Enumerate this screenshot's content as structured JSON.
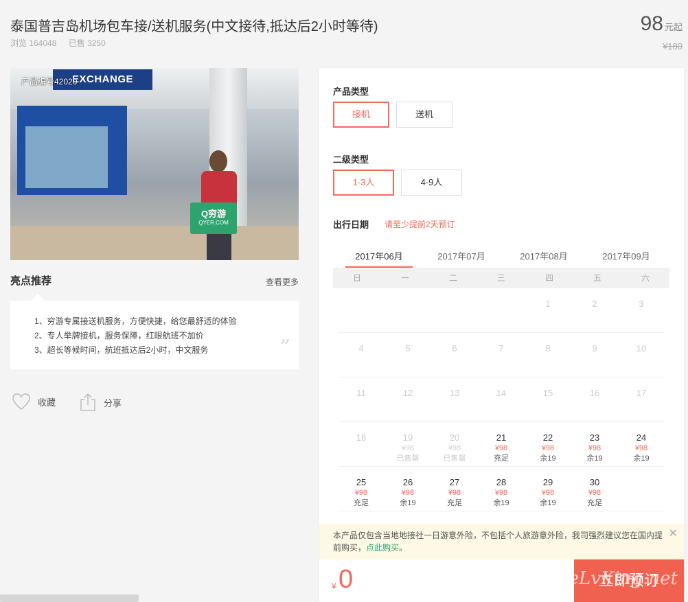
{
  "header": {
    "title": "泰国普吉岛机场包车接/送机服务(中文接待,抵达后2小时等待)",
    "views": "浏览 164048",
    "sold": "已售 3250",
    "price": "98",
    "price_suffix": "元起",
    "original_price": "¥180"
  },
  "hero": {
    "product_code": "产品编号42020",
    "sign_text": "EXCHANGE",
    "board_text": "Q穷游",
    "board_sub": "QYER.COM"
  },
  "highlights": {
    "title": "亮点推荐",
    "more": "查看更多",
    "items": [
      "1、穷游专属接送机服务，方便快捷，给您最舒适的体验",
      "2、专人举牌接机，服务保障，红眼航班不加价",
      "3、超长等候时间，航班抵达后2小时，中文服务"
    ]
  },
  "actions": {
    "favorite": "收藏",
    "share": "分享"
  },
  "booking": {
    "product_type_label": "产品类型",
    "product_types": [
      "接机",
      "送机"
    ],
    "sub_type_label": "二级类型",
    "sub_types": [
      "1-3人",
      "4-9人"
    ],
    "date_label": "出行日期",
    "date_hint": "请至少提前2天预订",
    "months": [
      "2017年06月",
      "2017年07月",
      "2017年08月",
      "2017年09月"
    ],
    "weekdays": [
      "日",
      "一",
      "二",
      "三",
      "四",
      "五",
      "六"
    ],
    "calendar": [
      [
        null,
        null,
        null,
        null,
        {
          "d": "1",
          "past": true
        },
        {
          "d": "2",
          "past": true
        },
        {
          "d": "3",
          "past": true
        }
      ],
      [
        {
          "d": "4",
          "past": true
        },
        {
          "d": "5",
          "past": true
        },
        {
          "d": "6",
          "past": true
        },
        {
          "d": "7",
          "past": true
        },
        {
          "d": "8",
          "past": true
        },
        {
          "d": "9",
          "past": true
        },
        {
          "d": "10",
          "past": true
        }
      ],
      [
        {
          "d": "11",
          "past": true
        },
        {
          "d": "12",
          "past": true
        },
        {
          "d": "13",
          "past": true
        },
        {
          "d": "14",
          "past": true
        },
        {
          "d": "15",
          "past": true
        },
        {
          "d": "16",
          "past": true
        },
        {
          "d": "17",
          "past": true
        }
      ],
      [
        {
          "d": "18",
          "past": true
        },
        {
          "d": "19",
          "past": true,
          "p": "¥98",
          "s": "已售罄",
          "sold": true
        },
        {
          "d": "20",
          "past": true,
          "p": "¥98",
          "s": "已售罄",
          "sold": true
        },
        {
          "d": "21",
          "p": "¥98",
          "s": "充足"
        },
        {
          "d": "22",
          "p": "¥98",
          "s": "余19"
        },
        {
          "d": "23",
          "p": "¥98",
          "s": "余19"
        },
        {
          "d": "24",
          "p": "¥98",
          "s": "余19"
        }
      ],
      [
        {
          "d": "25",
          "p": "¥98",
          "s": "充足"
        },
        {
          "d": "26",
          "p": "¥98",
          "s": "余19"
        },
        {
          "d": "27",
          "p": "¥98",
          "s": "充足"
        },
        {
          "d": "28",
          "p": "¥98",
          "s": "余19"
        },
        {
          "d": "29",
          "p": "¥98",
          "s": "余19"
        },
        {
          "d": "30",
          "p": "¥98",
          "s": "充足"
        },
        null
      ]
    ],
    "notice_text": "本产品仅包含当地地接社一日游意外险，不包括个人旅游意外险，我司强烈建议您在国内提前购买，",
    "notice_link": "点此购买",
    "notice_end": "。",
    "currency": "¥",
    "total": "0",
    "book_label": "立即预订"
  },
  "watermark": "eLvKing.net",
  "colors": {
    "accent": "#f06a5a",
    "button": "#f0614f",
    "link": "#2a9a73"
  }
}
